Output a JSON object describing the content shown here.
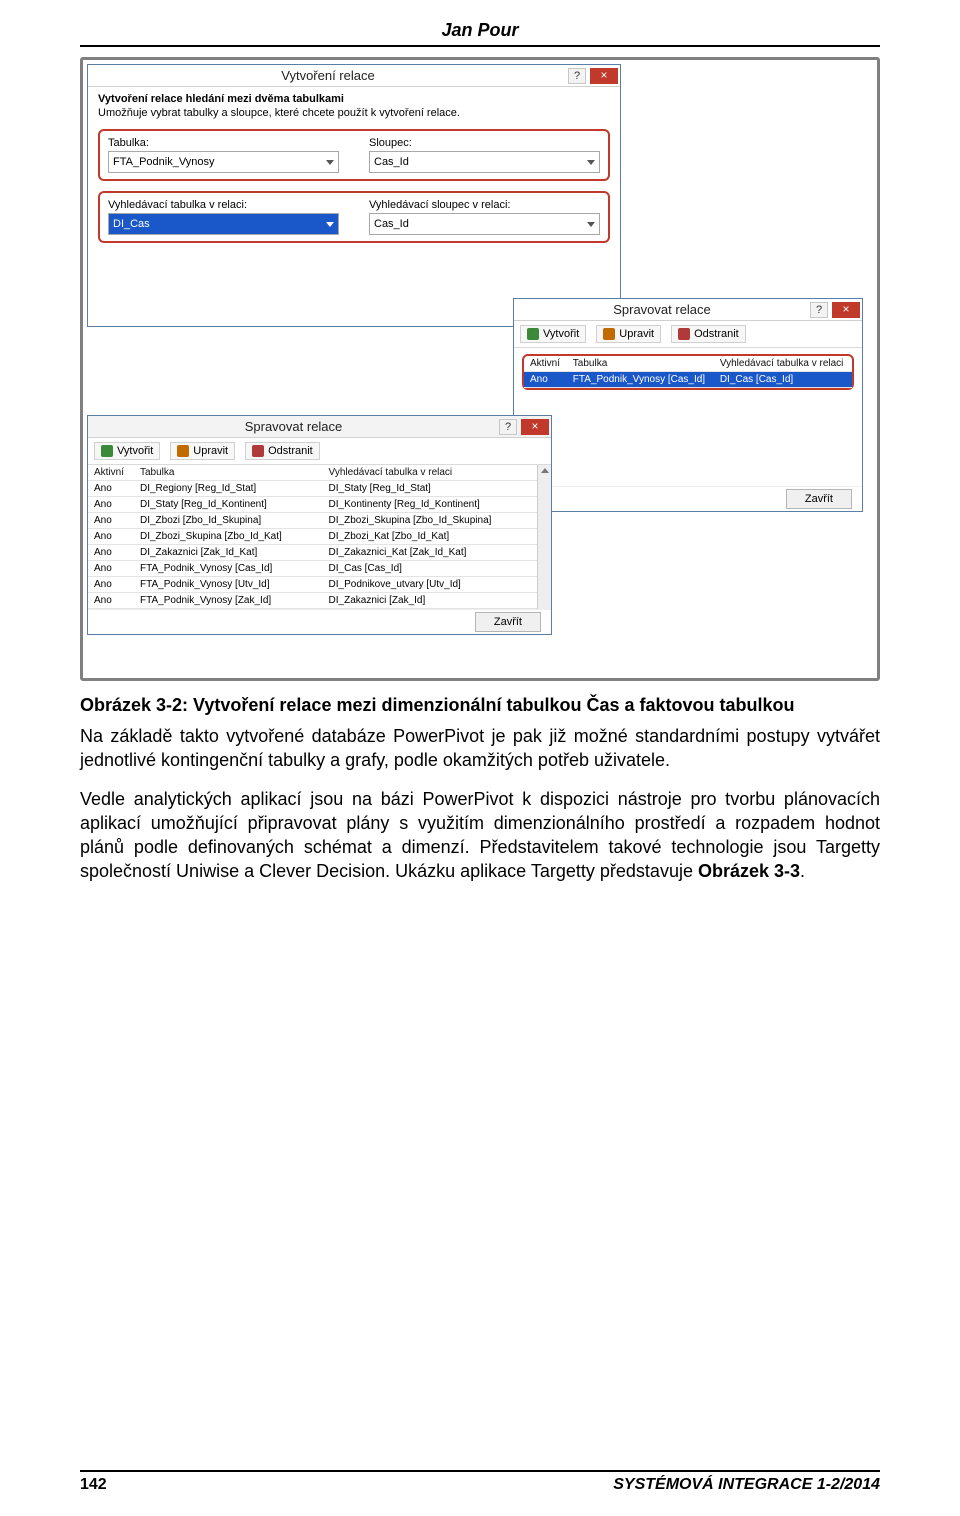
{
  "header": {
    "author": "Jan Pour"
  },
  "create_dlg": {
    "title": "Vytvoření relace",
    "heading": "Vytvoření relace hledání mezi dvěma tabulkami",
    "subtext": "Umožňuje vybrat tabulky a sloupce, které chcete použít k vytvoření relace.",
    "box1": {
      "table_label": "Tabulka:",
      "table_value": "FTA_Podnik_Vynosy",
      "column_label": "Sloupec:",
      "column_value": "Cas_Id"
    },
    "box2": {
      "lookup_table_label": "Vyhledávací tabulka v relaci:",
      "lookup_table_value": "DI_Cas",
      "lookup_column_label": "Vyhledávací sloupec v relaci:",
      "lookup_column_value": "Cas_Id"
    }
  },
  "manage_small": {
    "title": "Spravovat relace",
    "create": "Vytvořit",
    "edit": "Upravit",
    "delete": "Odstranit",
    "cols": {
      "active": "Aktivní",
      "table": "Tabulka",
      "lookup": "Vyhledávací tabulka v relaci"
    },
    "row": {
      "active": "Ano",
      "table": "FTA_Podnik_Vynosy [Cas_Id]",
      "lookup": "DI_Cas [Cas_Id]"
    },
    "close": "Zavřít"
  },
  "manage_large": {
    "title": "Spravovat relace",
    "create": "Vytvořit",
    "edit": "Upravit",
    "delete": "Odstranit",
    "cols": {
      "active": "Aktivní",
      "table": "Tabulka",
      "lookup": "Vyhledávací tabulka v relaci"
    },
    "rows": [
      {
        "active": "Ano",
        "table": "DI_Regiony [Reg_Id_Stat]",
        "lookup": "DI_Staty [Reg_Id_Stat]"
      },
      {
        "active": "Ano",
        "table": "DI_Staty [Reg_Id_Kontinent]",
        "lookup": "DI_Kontinenty [Reg_Id_Kontinent]"
      },
      {
        "active": "Ano",
        "table": "DI_Zbozi [Zbo_Id_Skupina]",
        "lookup": "DI_Zbozi_Skupina [Zbo_Id_Skupina]"
      },
      {
        "active": "Ano",
        "table": "DI_Zbozi_Skupina [Zbo_Id_Kat]",
        "lookup": "DI_Zbozi_Kat [Zbo_Id_Kat]"
      },
      {
        "active": "Ano",
        "table": "DI_Zakaznici [Zak_Id_Kat]",
        "lookup": "DI_Zakaznici_Kat [Zak_Id_Kat]"
      },
      {
        "active": "Ano",
        "table": "FTA_Podnik_Vynosy [Cas_Id]",
        "lookup": "DI_Cas [Cas_Id]"
      },
      {
        "active": "Ano",
        "table": "FTA_Podnik_Vynosy [Utv_Id]",
        "lookup": "DI_Podnikove_utvary [Utv_Id]"
      },
      {
        "active": "Ano",
        "table": "FTA_Podnik_Vynosy [Zak_Id]",
        "lookup": "DI_Zakaznici [Zak_Id]"
      }
    ],
    "close": "Zavřít"
  },
  "caption": "Obrázek 3-2: Vytvoření relace mezi dimenzionální tabulkou Čas a faktovou tabulkou",
  "para1": "Na základě takto vytvořené databáze PowerPivot je pak již možné standardními postupy vytvářet jednotlivé kontingenční tabulky a grafy, podle okamžitých potřeb uživatele.",
  "para2_part1": "Vedle analytických aplikací jsou na bázi PowerPivot k dispozici nástroje pro tvorbu plánovacích aplikací umožňující připravovat plány s využitím dimenzionálního prostředí a rozpadem hodnot plánů podle definovaných schémat a dimenzí. Představitelem takové technologie jsou Targetty společností Uniwise a Clever Decision. Ukázku aplikace Targetty představuje ",
  "para2_ref": "Obrázek 3-3",
  "para2_part2": ".",
  "footer": {
    "page": "142",
    "issue": "SYSTÉMOVÁ INTEGRACE 1-2/2014"
  }
}
